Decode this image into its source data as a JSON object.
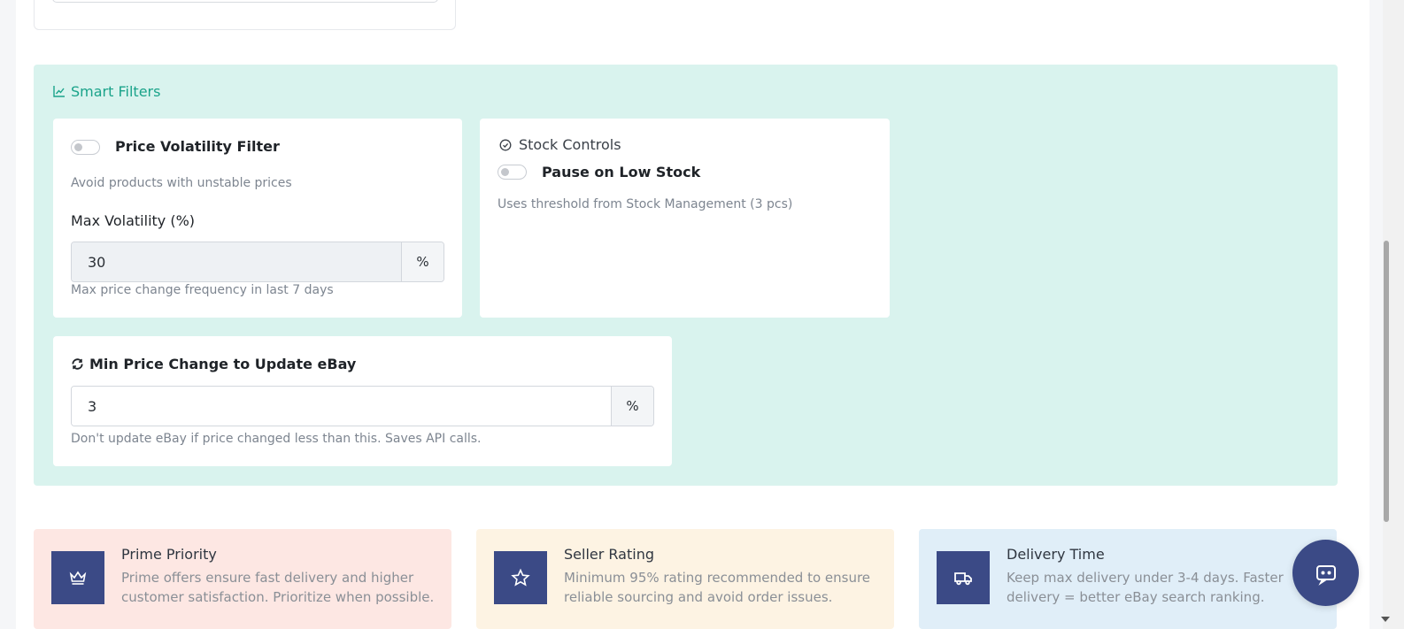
{
  "smart_filters": {
    "title": "Smart Filters",
    "accent": "#1aa38a",
    "background": "#d9f3ee",
    "volatility": {
      "toggle_label": "Price Volatility Filter",
      "toggle_on": false,
      "description": "Avoid products with unstable prices",
      "field_label": "Max Volatility (%)",
      "value": "30",
      "unit": "%",
      "help": "Max price change frequency in last 7 days"
    },
    "stock": {
      "title": "Stock Controls",
      "toggle_label": "Pause on Low Stock",
      "toggle_on": false,
      "help": "Uses threshold from Stock Management (3 pcs)"
    },
    "min_change": {
      "title": "Min Price Change to Update eBay",
      "value": "3",
      "unit": "%",
      "help": "Don't update eBay if price changed less than this. Saves API calls."
    }
  },
  "tips": [
    {
      "icon": "crown-icon",
      "title": "Prime Priority",
      "text": "Prime offers ensure fast delivery and higher customer satisfaction. Prioritize when possible."
    },
    {
      "icon": "star-icon",
      "title": "Seller Rating",
      "text": "Minimum 95% rating recommended to ensure reliable sourcing and avoid order issues."
    },
    {
      "icon": "truck-icon",
      "title": "Delivery Time",
      "text": "Keep max delivery under 3-4 days. Faster delivery = better eBay search ranking."
    }
  ],
  "colors": {
    "icon_box": "#3b4a86",
    "prime_bg": "#fde7e3",
    "seller_bg": "#fdf3e3",
    "delivery_bg": "#e0eef8"
  },
  "chat": {
    "icon": "chat-bot-icon"
  }
}
